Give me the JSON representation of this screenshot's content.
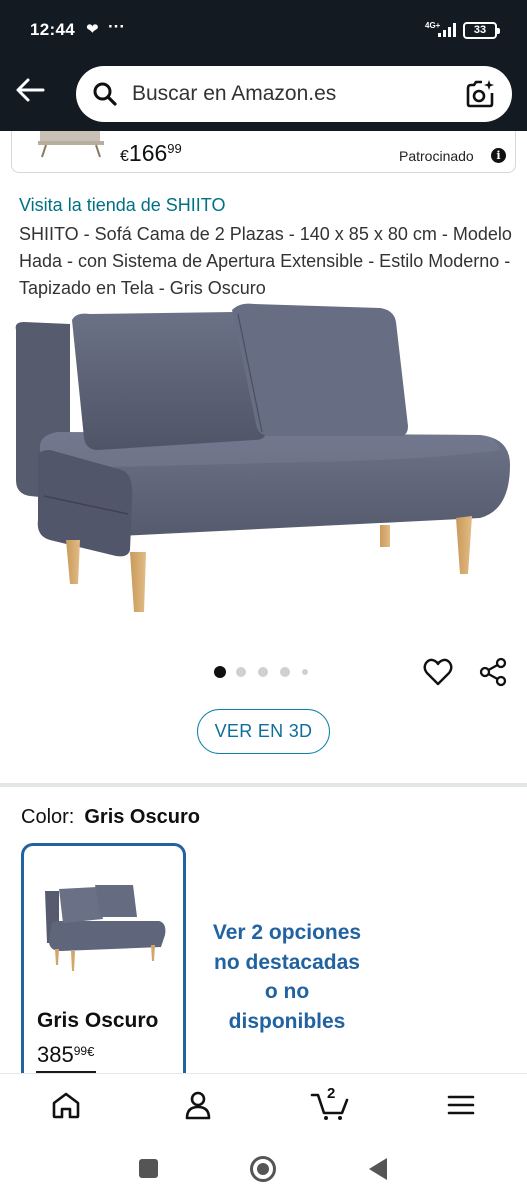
{
  "status_bar": {
    "time": "12:44",
    "network": "4G+",
    "battery": "33"
  },
  "header": {
    "search_placeholder": "Buscar en Amazon.es"
  },
  "sponsored": {
    "price_currency": "€",
    "price_whole": "166",
    "price_fraction": "99",
    "label": "Patrocinado"
  },
  "product": {
    "store_link": "Visita la tienda de SHIITO",
    "title": "SHIITO - Sofá Cama de 2 Plazas - 140 x 85 x 80 cm - Modelo Hada - con Sistema de Apertura Extensible - Estilo Moderno - Tapizado en Tela - Gris Oscuro",
    "image_count": 5,
    "active_image": 1,
    "ver3d_label": "VER EN 3D"
  },
  "variation": {
    "label": "Color:",
    "selected": "Gris Oscuro",
    "swatch_name": "Gris Oscuro",
    "swatch_price_whole": "385",
    "swatch_price_fraction": "99",
    "swatch_currency": "€",
    "more_options": "Ver 2 opciones no destacadas o no disponibles"
  },
  "bottom_nav": {
    "items": [
      "home-icon",
      "account-icon",
      "cart-icon",
      "menu-icon"
    ],
    "cart_count": "2"
  },
  "colors": {
    "header_bg": "#131a22",
    "link": "#007185",
    "swatch_border": "#2162a1",
    "sofa": "#5c6277"
  }
}
